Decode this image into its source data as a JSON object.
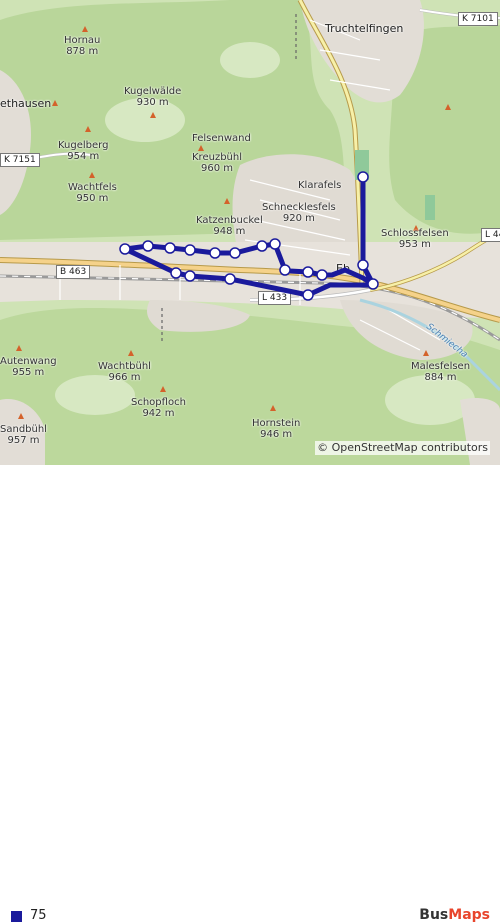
{
  "map": {
    "attribution": "© OpenStreetMap contributors",
    "route_color": "#1a1a9c",
    "places": [
      {
        "name": "Hornau",
        "elev": "878 m"
      },
      {
        "name": "Kugelwälde",
        "elev": "930 m"
      },
      {
        "name": "Felsenwand",
        "elev": ""
      },
      {
        "name": "Kreuzbühl",
        "elev": "960 m"
      },
      {
        "name": "Kugelberg",
        "elev": "954 m"
      },
      {
        "name": "Wachtfels",
        "elev": "950 m"
      },
      {
        "name": "Katzenbuckel",
        "elev": "948 m"
      },
      {
        "name": "Schnecklesfels",
        "elev": "920 m"
      },
      {
        "name": "Klarafels",
        "elev": ""
      },
      {
        "name": "Schlossfelsen",
        "elev": "953 m"
      },
      {
        "name": "Autenwang",
        "elev": "955 m"
      },
      {
        "name": "Wachtbühl",
        "elev": "966 m"
      },
      {
        "name": "Schopfloch",
        "elev": "942 m"
      },
      {
        "name": "Hornstein",
        "elev": "946 m"
      },
      {
        "name": "Sandbühl",
        "elev": "957 m"
      },
      {
        "name": "Malesfelsen",
        "elev": "884 m"
      }
    ],
    "towns": [
      "Truchtelfingen",
      "ethausen",
      "Eb"
    ],
    "roads": [
      "K 7101",
      "K 7151",
      "B 463",
      "L 433",
      "L 44"
    ],
    "river": "Schmiecha"
  },
  "legend": {
    "line_label": "75",
    "line_color": "#1a1a9c"
  },
  "brand": {
    "part1": "Bus",
    "part2": "Maps"
  }
}
